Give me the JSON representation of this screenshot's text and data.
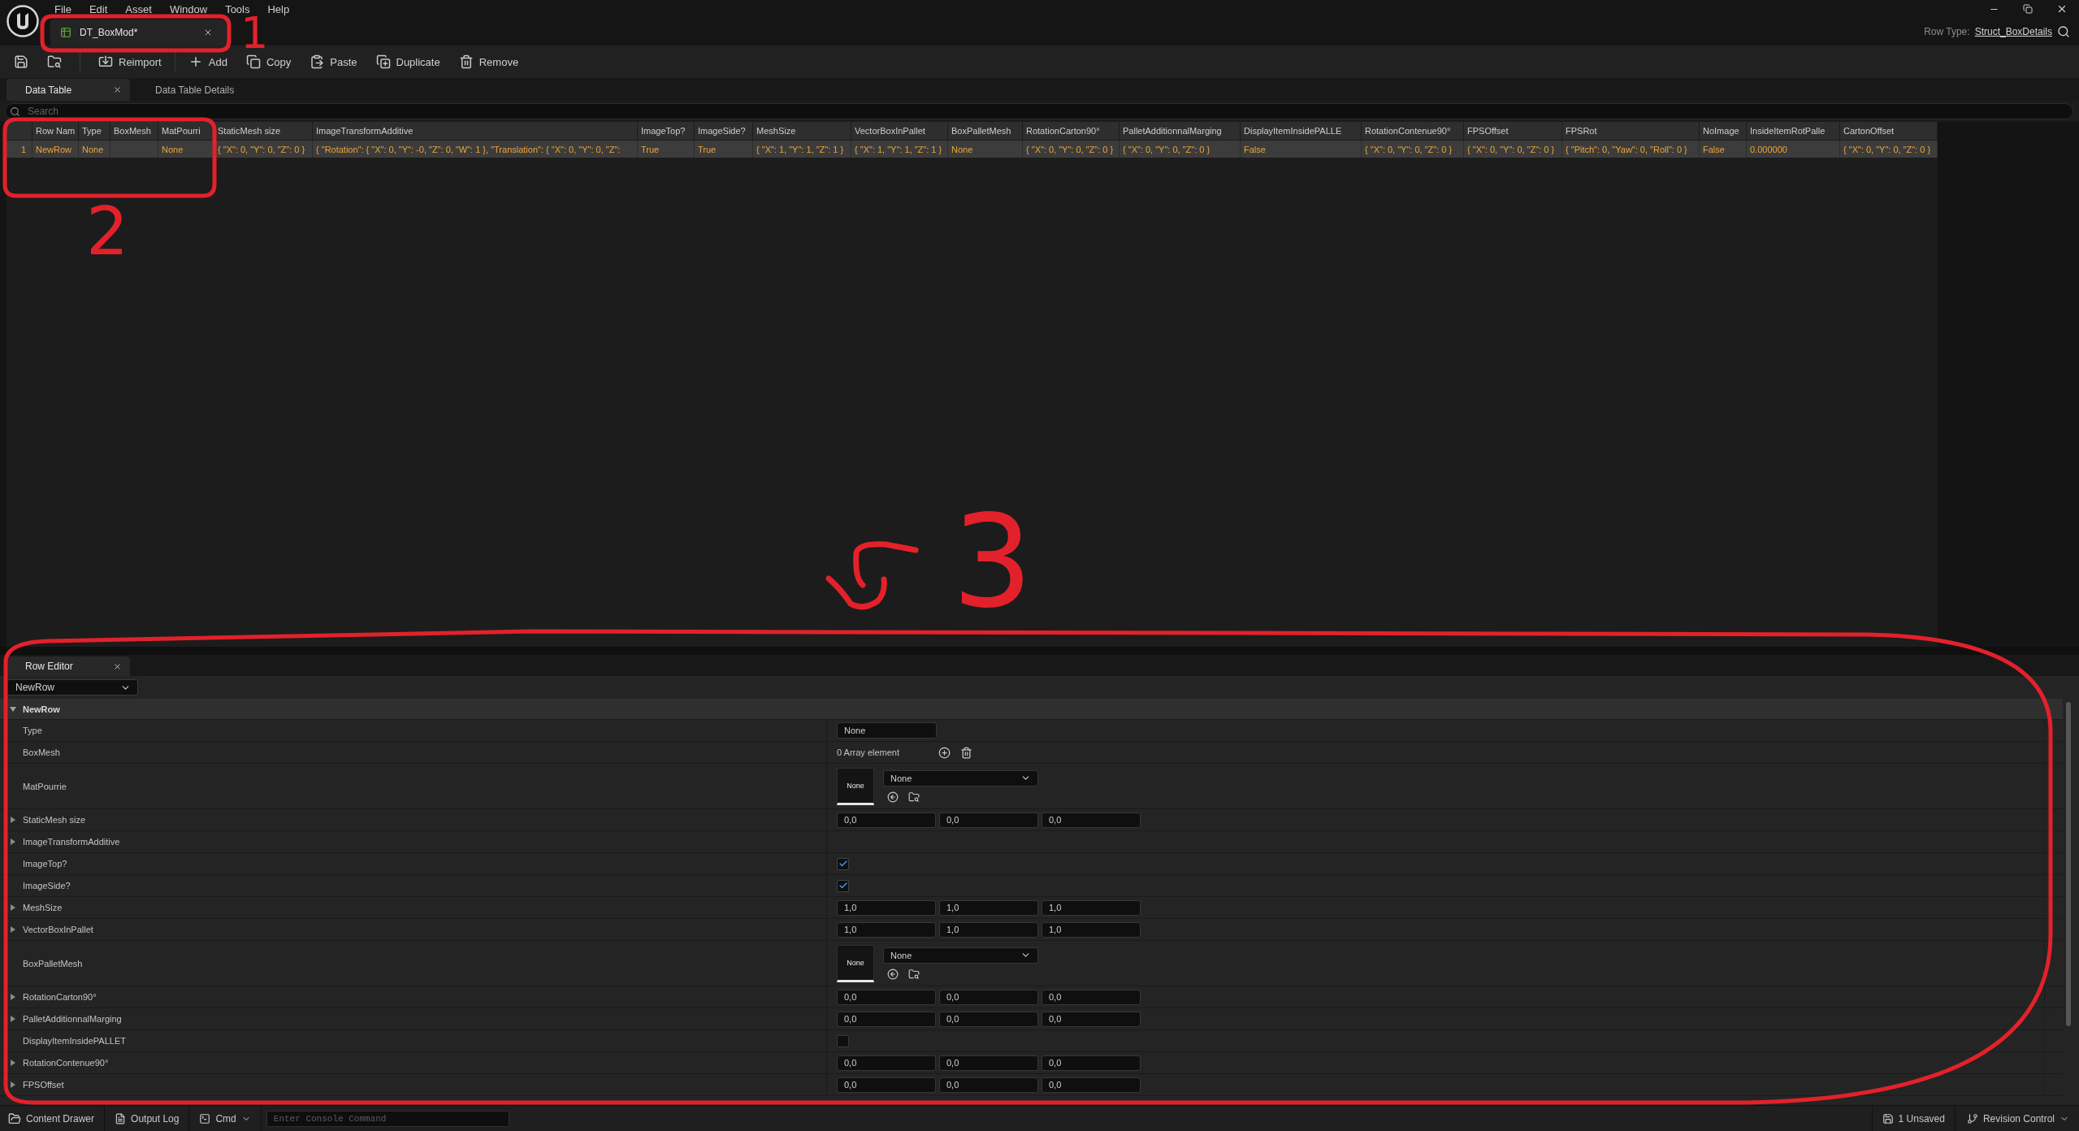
{
  "title_bar": {
    "menu": [
      "File",
      "Edit",
      "Asset",
      "Window",
      "Tools",
      "Help"
    ],
    "document_tabs": [
      {
        "label": "DT_BoxMod*",
        "selected": true
      }
    ],
    "row_type": {
      "label": "Row Type:",
      "value": "Struct_BoxDetails"
    }
  },
  "toolbar": [
    {
      "kind": "reimport",
      "label": "Reimport"
    },
    {
      "kind": "add",
      "label": "Add"
    },
    {
      "kind": "copy",
      "label": "Copy"
    },
    {
      "kind": "paste",
      "label": "Paste"
    },
    {
      "kind": "duplicate",
      "label": "Duplicate"
    },
    {
      "kind": "remove",
      "label": "Remove"
    }
  ],
  "panel_tabs": [
    {
      "label": "Data Table",
      "selected": true
    },
    {
      "label": "Data Table Details",
      "selected": false
    }
  ],
  "search": {
    "placeholder": "Search"
  },
  "table": {
    "columns": [
      "Row Nam",
      "Type",
      "BoxMesh",
      "MatPourri",
      "StaticMesh size",
      "ImageTransformAdditive",
      "ImageTop?",
      "ImageSide?",
      "MeshSize",
      "VectorBoxInPallet",
      "BoxPalletMesh",
      "RotationCarton90°",
      "PalletAdditionnalMarging",
      "DisplayItemInsidePALLE",
      "RotationContenue90°",
      "FPSOffset",
      "FPSRot",
      "NoImage",
      "InsideItemRotPalle",
      "CartonOffset"
    ],
    "rows": [
      {
        "number": "1",
        "selected": true,
        "cells": [
          "NewRow",
          "None",
          null,
          "None",
          "{ \"X\": 0, \"Y\": 0, \"Z\": 0 }",
          "{ \"Rotation\": { \"X\": 0, \"Y\": -0, \"Z\": 0, \"W\": 1 }, \"Translation\": { \"X\": 0, \"Y\": 0, \"Z\":",
          "True",
          "True",
          "{ \"X\": 1, \"Y\": 1, \"Z\": 1 }",
          "{ \"X\": 1, \"Y\": 1, \"Z\": 1 }",
          "None",
          "{ \"X\": 0, \"Y\": 0, \"Z\": 0 }",
          "{ \"X\": 0, \"Y\": 0, \"Z\": 0 }",
          "False",
          "{ \"X\": 0, \"Y\": 0, \"Z\": 0 }",
          "{ \"X\": 0, \"Y\": 0, \"Z\": 0 }",
          "{ \"Pitch\": 0, \"Yaw\": 0, \"Roll\": 0 }",
          "False",
          "0.000000",
          "{ \"X\": 0, \"Y\": 0, \"Z\": 0 }"
        ]
      }
    ]
  },
  "row_editor": {
    "tab": {
      "label": "Row Editor",
      "selected": true
    },
    "row_picker": {
      "value": "NewRow"
    },
    "category": {
      "label": "NewRow",
      "expanded": true
    },
    "properties": [
      {
        "label": "Type",
        "kind": "text",
        "value": "None"
      },
      {
        "label": "BoxMesh",
        "kind": "array",
        "value": "0 Array element"
      },
      {
        "label": "MatPourrie",
        "kind": "asset",
        "thumbnail": "None",
        "value": "None"
      },
      {
        "label": "StaticMesh size",
        "kind": "vector",
        "expanded": false,
        "values": [
          "0,0",
          "0,0",
          "0,0"
        ]
      },
      {
        "label": "ImageTransformAdditive",
        "kind": "struct",
        "expanded": false
      },
      {
        "label": "ImageTop?",
        "kind": "checkbox",
        "checked": true
      },
      {
        "label": "ImageSide?",
        "kind": "checkbox",
        "checked": true
      },
      {
        "label": "MeshSize",
        "kind": "vector",
        "expanded": false,
        "values": [
          "1,0",
          "1,0",
          "1,0"
        ]
      },
      {
        "label": "VectorBoxInPallet",
        "kind": "vector",
        "expanded": false,
        "values": [
          "1,0",
          "1,0",
          "1,0"
        ]
      },
      {
        "label": "BoxPalletMesh",
        "kind": "asset",
        "thumbnail": "None",
        "value": "None"
      },
      {
        "label": "RotationCarton90°",
        "kind": "vector",
        "expanded": false,
        "values": [
          "0,0",
          "0,0",
          "0,0"
        ]
      },
      {
        "label": "PalletAdditionnalMarging",
        "kind": "vector",
        "expanded": false,
        "values": [
          "0,0",
          "0,0",
          "0,0"
        ]
      },
      {
        "label": "DisplayItemInsidePALLET",
        "kind": "checkbox",
        "checked": false
      },
      {
        "label": "RotationContenue90°",
        "kind": "vector",
        "expanded": false,
        "values": [
          "0,0",
          "0,0",
          "0,0"
        ]
      },
      {
        "label": "FPSOffset",
        "kind": "vector",
        "expanded": false,
        "values": [
          "0,0",
          "0,0",
          "0,0"
        ]
      }
    ]
  },
  "status_bar": {
    "left": [
      {
        "kind": "drawer",
        "label": "Content Drawer"
      },
      {
        "kind": "log",
        "label": "Output Log"
      },
      {
        "kind": "cmd",
        "label": "Cmd"
      }
    ],
    "console": {
      "placeholder": "Enter Console Command"
    },
    "right": [
      {
        "kind": "unsaved",
        "label": "1 Unsaved"
      },
      {
        "kind": "revision",
        "label": "Revision Control"
      }
    ]
  },
  "annotations": [
    {
      "kind": "box",
      "label": "1"
    },
    {
      "kind": "box",
      "label": "2"
    },
    {
      "kind": "ellipse",
      "label": "3"
    }
  ]
}
